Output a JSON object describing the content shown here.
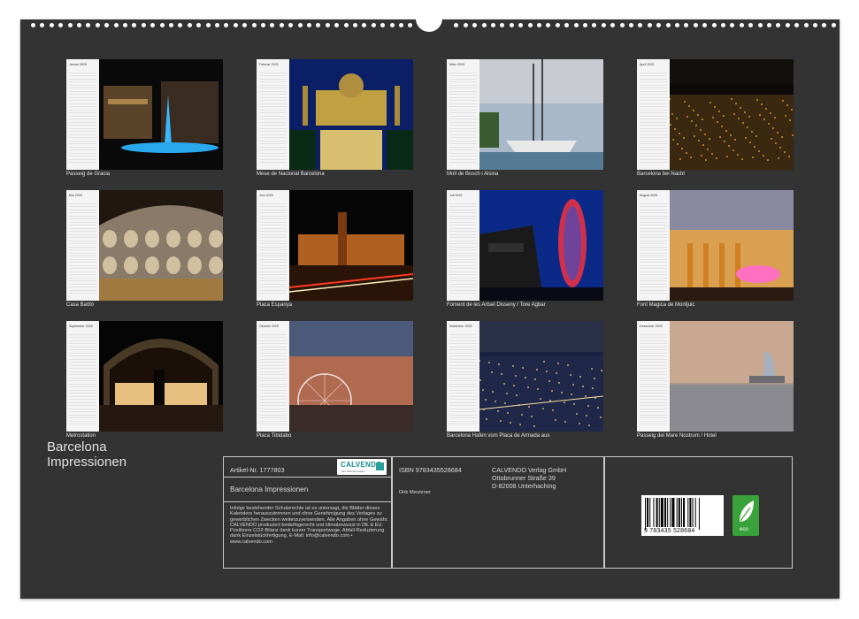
{
  "months": [
    {
      "name": "Januar 2025",
      "caption": "Passeig de Gracia"
    },
    {
      "name": "Februar 2025",
      "caption": "Mese de Nacional Barcelona"
    },
    {
      "name": "März 2025",
      "caption": "Moll de Bosch i Alsina"
    },
    {
      "name": "April 2025",
      "caption": "Barcelona bei Nacht"
    },
    {
      "name": "Mai 2025",
      "caption": "Casa Battló"
    },
    {
      "name": "Juni 2025",
      "caption": "Placa Espanya"
    },
    {
      "name": "Juli 2025",
      "caption": "Foment de les Artsel Disseny / Tore Agbar"
    },
    {
      "name": "August 2025",
      "caption": "Font Magica de Montjuic"
    },
    {
      "name": "September 2025",
      "caption": "Metrostation"
    },
    {
      "name": "Oktober 2025",
      "caption": "Placa Tibidabo"
    },
    {
      "name": "November 2025",
      "caption": "Barcelona Hafen vom Placa de Armada aus"
    },
    {
      "name": "Dezember 2025",
      "caption": "Passeig del Mare Nostrum / Hotel"
    }
  ],
  "title_line1": "Barcelona",
  "title_line2": "Impressionen",
  "info": {
    "article": "Artikel-Nr. 1777803",
    "product_title": "Barcelona Impressionen",
    "legal": "Infolge bestehender Schutzrechte ist es untersagt, die Blätter dieses Kalenders herauszutrennen und ohne Genehmigung des Verlages zu gewerblichen Zwecken weiterzuverwenden. Alle Angaben ohne Gewähr. CALVENDO produziert bedarfsgerecht und klimabewusst in DE & EU. Positivere CO2-Bilanz dank kurzer Transportwege. Abfall-Reduzierung dank Einzelstückfertigung. E-Mail: info@calvendo.com • www.calvendo.com",
    "isbn": "ISBN 9783435528684",
    "author": "Dirk Meutzner",
    "publisher_line1": "CALVENDO Verlag GmbH",
    "publisher_line2": "Ottobrunner Straße 39",
    "publisher_line3": "D-82008 Unterhaching",
    "logo_text": "CALVENDO",
    "logo_sub": "Ihre Kalendermarke",
    "barcode_number": "9  783435  528684",
    "eco_label": "eco"
  },
  "colors": {
    "sheet": "#333333",
    "accent": "#2a9d9d",
    "eco": "#3aa23a"
  }
}
